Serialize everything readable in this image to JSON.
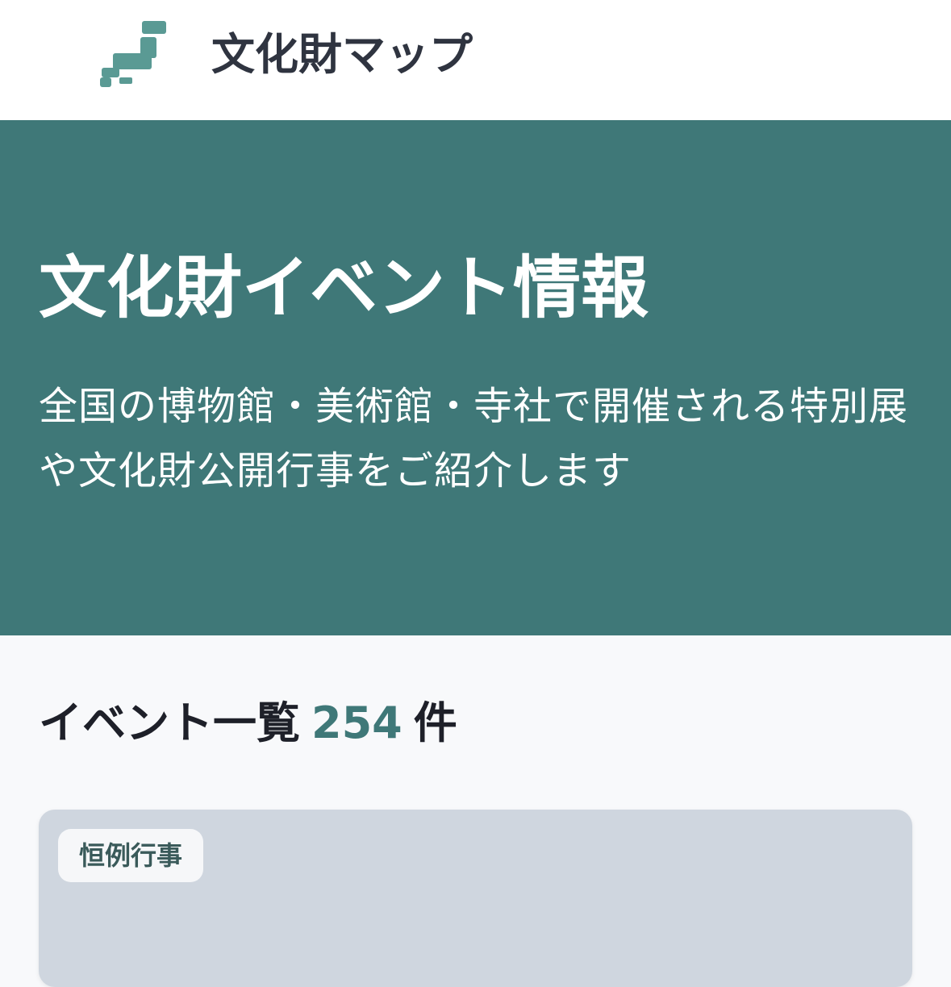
{
  "header": {
    "logo_icon": "japan-map-icon",
    "title": "文化財マップ"
  },
  "hero": {
    "title": "文化財イベント情報",
    "description": "全国の博物館・美術館・寺社で開催される特別展や文化財公開行事をご紹介します"
  },
  "list": {
    "heading": "イベント一覧",
    "count": "254",
    "unit": "件"
  },
  "cards": [
    {
      "badge": "恒例行事"
    }
  ],
  "colors": {
    "accent": "#3f7878",
    "logo": "#5a9a94",
    "card_placeholder": "#cfd6df"
  }
}
